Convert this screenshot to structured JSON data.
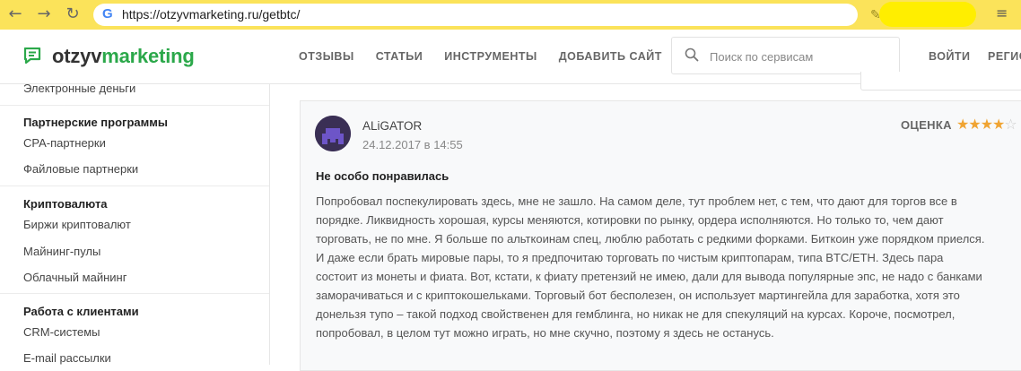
{
  "browser": {
    "url": "https://otzyvmarketing.ru/getbtc/",
    "back_icon": "arrow-left-icon",
    "forward_icon": "arrow-right-icon",
    "reload_icon": "reload-icon",
    "g_letter": "G",
    "menu_icon": "reading-list-icon"
  },
  "site": {
    "logo_part1": "otzyv",
    "logo_part2": "marketing",
    "brand_color": "#2ba84a",
    "nav": [
      "ОТЗЫВЫ",
      "СТАТЬИ",
      "ИНСТРУМЕНТЫ",
      "ДОБАВИТЬ САЙТ"
    ],
    "search_placeholder": "Поиск по сервисам",
    "login": "ВОЙТИ",
    "register": "РЕГИС"
  },
  "sidebar": {
    "top_item": "Электронные деньги",
    "groups": [
      {
        "title": "Партнерские программы",
        "items": [
          "CPA-партнерки",
          "Файловые партнерки"
        ]
      },
      {
        "title": "Криптовалюта",
        "items": [
          "Биржи криптовалют",
          "Майнинг-пулы",
          "Облачный майнинг"
        ]
      },
      {
        "title": "Работа с клиентами",
        "items": [
          "CRM-системы",
          "E-mail рассылки"
        ]
      }
    ]
  },
  "review": {
    "author": "ALiGATOR",
    "date": "24.12.2017 в 14:55",
    "rating_label": "ОЦЕНКА",
    "rating": 4,
    "rating_max": 5,
    "title": "Не особо понравилась",
    "lines": [
      "Попробовал поспекулировать здесь, мне не зашло. На самом деле, тут проблем нет, с тем, что дают для торгов все в",
      "порядке. Ликвидность хорошая, курсы меняются, котировки по рынку, ордера исполняются. Но только то, чем дают",
      "торговать, не по мне. Я больше по альткоинам спец, люблю работать с редкими форками. Биткоин уже порядком приелся.",
      "И даже если брать мировые пары, то я предпочитаю торговать по чистым криптопарам, типа BTC/ETH. Здесь пара",
      "состоит из монеты и фиата. Вот, кстати, к фиату претензий не имею, дали для вывода популярные эпс, не надо с банками",
      "заморачиваться и с криптокошельками. Торговый бот бесполезен, он использует мартингейла для заработка, хотя это",
      "донельзя тупо – такой подход свойственен для гемблинга, но никак не для спекуляций на курсах. Короче, посмотрел,",
      "попробовал, в целом тут можно играть, но мне скучно, поэтому я здесь не останусь."
    ]
  }
}
